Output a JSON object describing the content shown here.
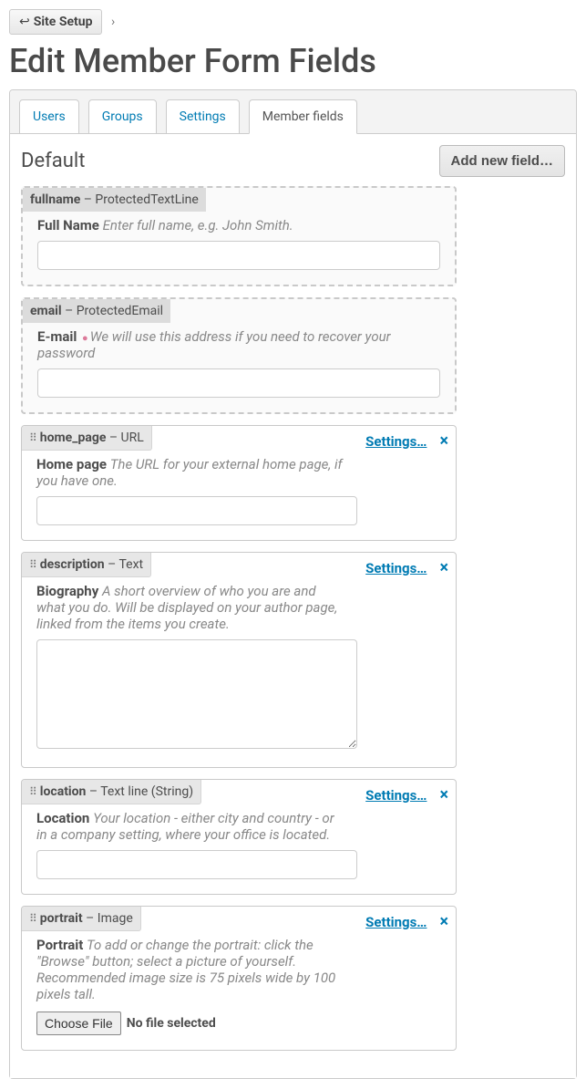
{
  "breadcrumb": {
    "site_setup": "Site Setup",
    "sep": "›"
  },
  "page_title": "Edit Member Form Fields",
  "tabs": [
    {
      "key": "users",
      "label": "Users"
    },
    {
      "key": "groups",
      "label": "Groups"
    },
    {
      "key": "settings",
      "label": "Settings"
    },
    {
      "key": "member_fields",
      "label": "Member fields"
    }
  ],
  "active_tab": "member_fields",
  "section": {
    "title": "Default",
    "add_button": "Add new field…"
  },
  "actions": {
    "settings": "Settings…",
    "delete": "×"
  },
  "file": {
    "choose": "Choose File",
    "none": "No file selected"
  },
  "fields": [
    {
      "id": "fullname",
      "name": "fullname",
      "type": "ProtectedTextLine",
      "protected": true,
      "draggable": false,
      "label": "Full Name",
      "required": false,
      "help": "Enter full name, e.g. John Smith.",
      "input_kind": "text"
    },
    {
      "id": "email",
      "name": "email",
      "type": "ProtectedEmail",
      "protected": true,
      "draggable": false,
      "label": "E-mail",
      "required": true,
      "help": "We will use this address if you need to recover your password",
      "input_kind": "text"
    },
    {
      "id": "home_page",
      "name": "home_page",
      "type": "URL",
      "protected": false,
      "draggable": true,
      "label": "Home page",
      "required": false,
      "help": "The URL for your external home page, if you have one.",
      "input_kind": "text"
    },
    {
      "id": "description",
      "name": "description",
      "type": "Text",
      "protected": false,
      "draggable": true,
      "label": "Biography",
      "required": false,
      "help": "A short overview of who you are and what you do. Will be displayed on your author page, linked from the items you create.",
      "input_kind": "textarea"
    },
    {
      "id": "location",
      "name": "location",
      "type": "Text line (String)",
      "protected": false,
      "draggable": true,
      "label": "Location",
      "required": false,
      "help": "Your location - either city and country - or in a company setting, where your office is located.",
      "input_kind": "text"
    },
    {
      "id": "portrait",
      "name": "portrait",
      "type": "Image",
      "protected": false,
      "draggable": true,
      "label": "Portrait",
      "required": false,
      "help": "To add or change the portrait: click the \"Browse\" button; select a picture of yourself. Recommended image size is 75 pixels wide by 100 pixels tall.",
      "input_kind": "file"
    }
  ]
}
